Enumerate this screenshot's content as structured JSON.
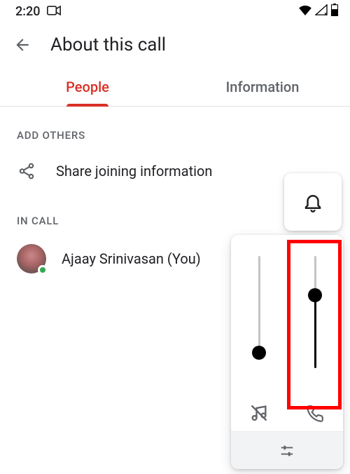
{
  "status": {
    "time": "2:20"
  },
  "appbar": {
    "title": "About this call"
  },
  "tabs": {
    "people": "People",
    "information": "Information"
  },
  "sections": {
    "add_others": "ADD OTHERS",
    "in_call": "IN CALL"
  },
  "actions": {
    "share_joining": "Share joining information"
  },
  "people": {
    "person1": "Ajaay Srinivasan (You)"
  }
}
